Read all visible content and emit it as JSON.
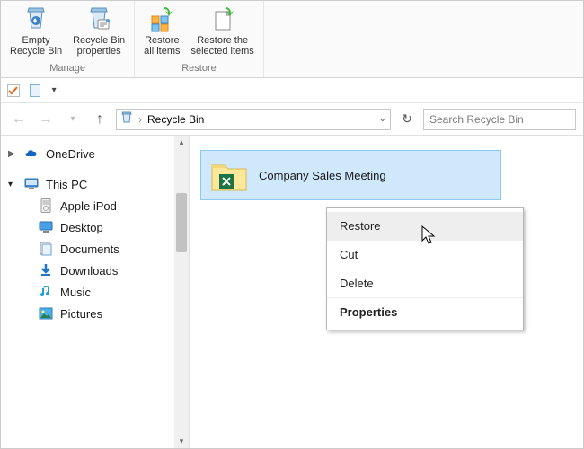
{
  "ribbon": {
    "manage": {
      "empty": "Empty\nRecycle Bin",
      "properties": "Recycle Bin\nproperties",
      "group_label": "Manage"
    },
    "restore": {
      "restore_all": "Restore\nall items",
      "restore_selected": "Restore the\nselected items",
      "group_label": "Restore"
    }
  },
  "address": {
    "location": "Recycle Bin"
  },
  "search": {
    "placeholder": "Search Recycle Bin"
  },
  "sidebar": {
    "onedrive": "OneDrive",
    "this_pc": "This PC",
    "items": [
      "Apple iPod",
      "Desktop",
      "Documents",
      "Downloads",
      "Music",
      "Pictures"
    ]
  },
  "file": {
    "name": "Company Sales Meeting"
  },
  "context_menu": {
    "restore": "Restore",
    "cut": "Cut",
    "delete": "Delete",
    "properties": "Properties"
  }
}
